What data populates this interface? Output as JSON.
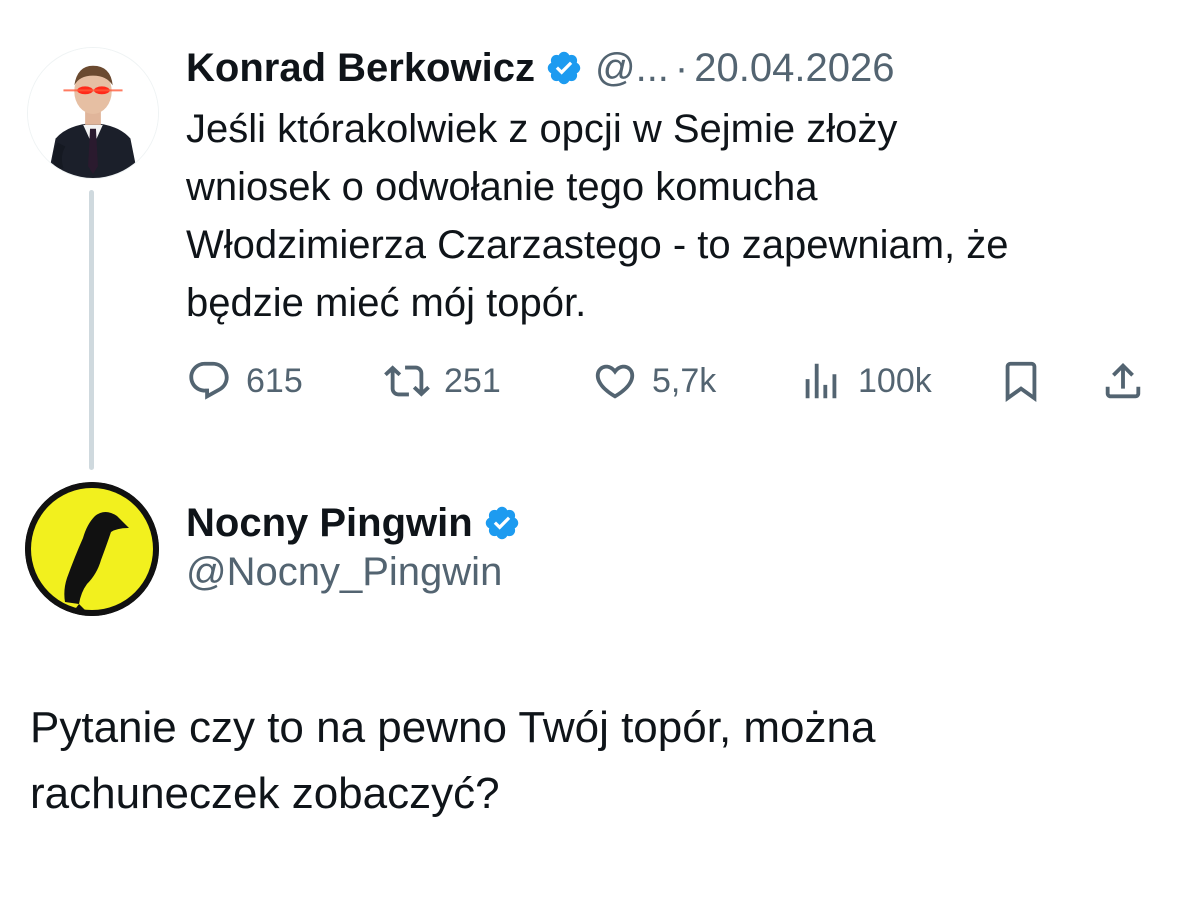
{
  "original_tweet": {
    "author_name": "Konrad Berkowicz",
    "handle_truncated": "@...",
    "separator": "·",
    "date": "20.04.2026",
    "text": "Jeśli którakolwiek z opcji w Sejmie złoży\nwniosek o odwołanie tego komucha\nWłodzimierza Czarzastego - to zapewniam, że\nbędzie mieć mój topór.",
    "actions": {
      "replies": "615",
      "retweets": "251",
      "likes": "5,7k",
      "views": "100k"
    },
    "icons": {
      "verified": "verified-badge-icon",
      "reply": "comment-bubble-icon",
      "retweet": "retweet-icon",
      "like": "heart-icon",
      "views": "bar-chart-icon",
      "bookmark": "bookmark-icon",
      "share": "share-upload-icon"
    }
  },
  "reply_tweet": {
    "author_name": "Nocny Pingwin",
    "handle": "@Nocny_Pingwin",
    "text": "Pytanie czy to na pewno Twój topór, można\nrachuneczek zobaczyć?"
  },
  "colors": {
    "verified_blue": "#1d9bf0",
    "secondary_text": "#536471",
    "primary_text": "#0f1419",
    "thread_line": "#cfd9de",
    "pingwin_avatar_bg": "#f2f01e"
  }
}
